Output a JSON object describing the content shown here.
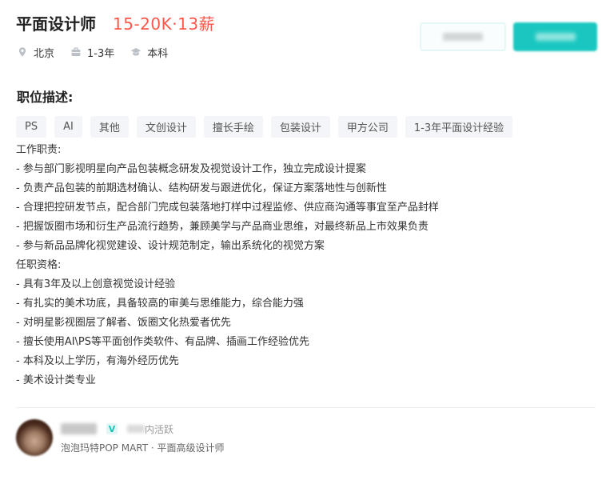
{
  "job": {
    "title": "平面设计师",
    "salary": "15-20K·13薪",
    "location": "北京",
    "experience": "1-3年",
    "education": "本科"
  },
  "icons": {
    "location": "location-pin-icon",
    "experience": "briefcase-icon",
    "education": "graduation-cap-icon",
    "verified": "verified-badge-icon"
  },
  "section_title": "职位描述:",
  "tags": [
    "PS",
    "AI",
    "其他",
    "文创设计",
    "擅长手绘",
    "包装设计",
    "甲方公司",
    "1-3年平面设计经验"
  ],
  "description": [
    "工作职责:",
    " - 参与部门影视明星向产品包装概念研发及视觉设计工作，独立完成设计提案",
    " - 负责产品包装的前期选材确认、结构研发与跟进优化，保证方案落地性与创新性",
    " - 合理把控研发节点，配合部门完成包装落地打样中过程监修、供应商沟通等事宜至产品封样",
    " - 把握饭圈市场和衍生产品流行趋势，兼顾美学与产品商业思维，对最终新品上市效果负责",
    " - 参与新品品牌化视觉建设、设计规范制定，输出系统化的视觉方案",
    "任职资格:",
    " - 具有3年及以上创意视觉设计经验",
    " - 有扎实的美术功底，具备较高的审美与思维能力，综合能力强",
    "- 对明星影视圈层了解者、饭圈文化热爱者优先",
    " - 擅长使用AI\\PS等平面创作类软件、有品牌、插画工作经验优先",
    " - 本科及以上学历，有海外经历优先",
    " - 美术设计类专业"
  ],
  "recruiter": {
    "verified_mark": "V",
    "active_suffix": "内活跃",
    "company_line": "泡泡玛特POP MART · 平面高级设计师"
  },
  "colors": {
    "accent": "#19c7c0",
    "salary": "#fe574a"
  }
}
